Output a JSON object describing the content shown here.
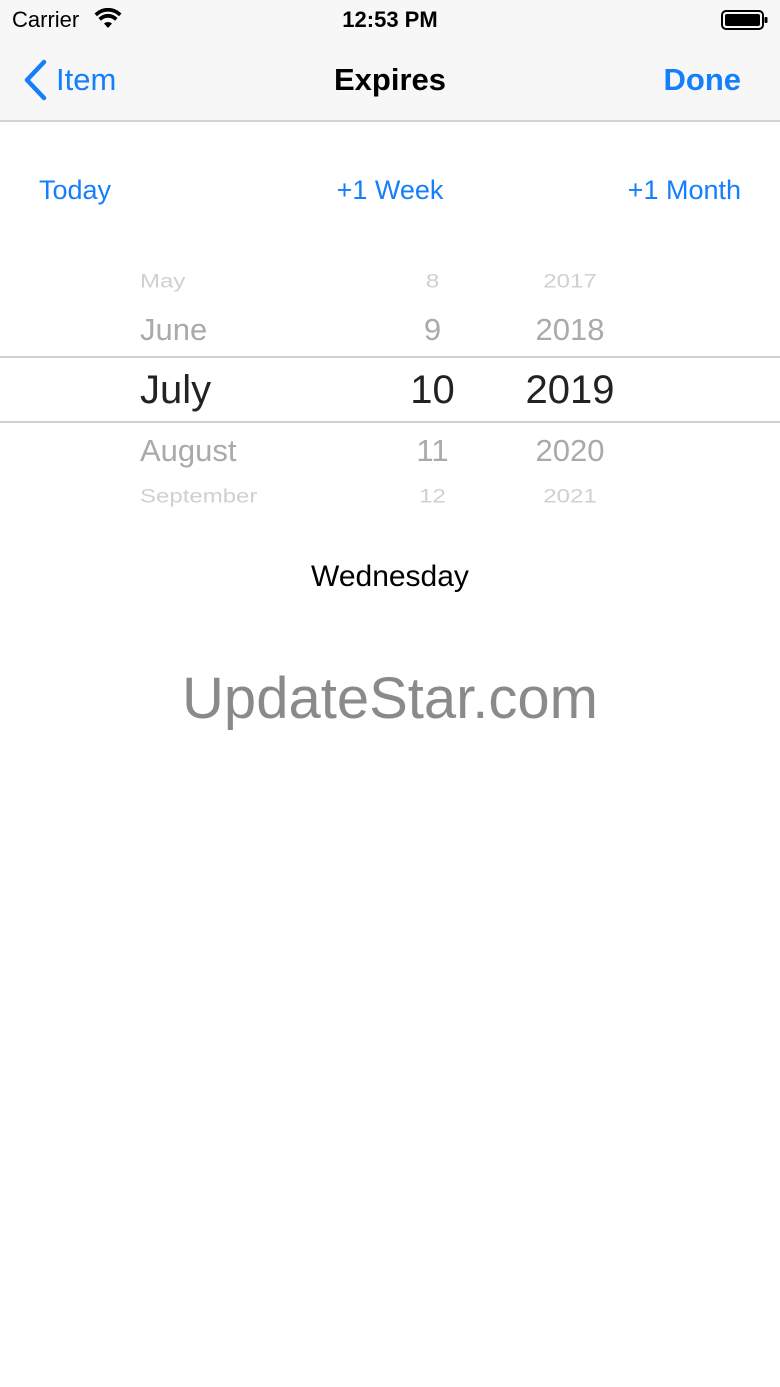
{
  "status_bar": {
    "carrier": "Carrier",
    "time": "12:53 PM"
  },
  "nav": {
    "back_label": "Item",
    "title": "Expires",
    "done_label": "Done"
  },
  "quick_buttons": {
    "today": "Today",
    "week": "+1 Week",
    "month": "+1 Month"
  },
  "picker": {
    "months": [
      "May",
      "June",
      "July",
      "August",
      "September"
    ],
    "days": [
      "8",
      "9",
      "10",
      "11",
      "12"
    ],
    "years": [
      "2017",
      "2018",
      "2019",
      "2020",
      "2021"
    ]
  },
  "weekday": "Wednesday",
  "watermark": "UpdateStar.com",
  "colors": {
    "accent": "#147efb",
    "bar_background": "#f7f7f7"
  }
}
